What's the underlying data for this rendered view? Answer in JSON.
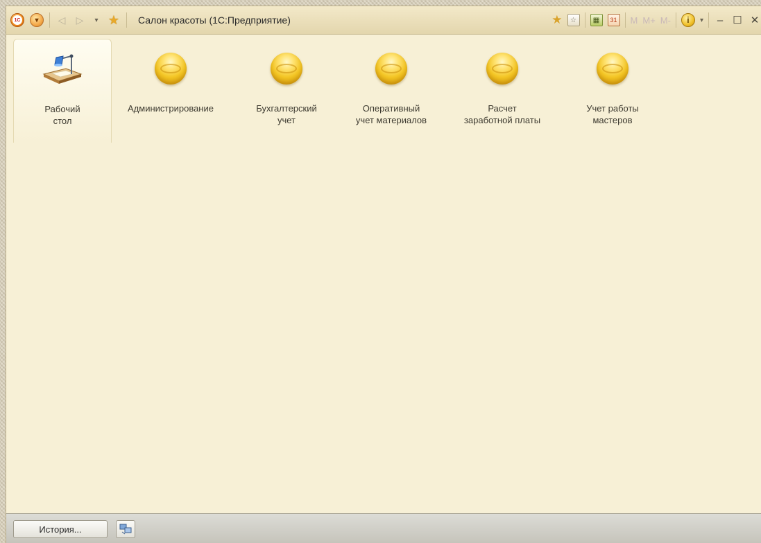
{
  "window": {
    "title": "Салон красоты  (1С:Предприятие)"
  },
  "toolbar_left": {
    "logo_text": "1С",
    "menu_glyph": "▾",
    "back_glyph": "◁",
    "forward_glyph": "▷",
    "history_drop_glyph": "▾",
    "favorites_glyph": "★"
  },
  "toolbar_right": {
    "add_fav_glyph": "★",
    "fav_list_glyph": "☆",
    "calc_glyph": "▦",
    "calendar_glyph": "31",
    "mem_labels": [
      "M",
      "M+",
      "M-"
    ],
    "info_glyph": "i",
    "info_drop_glyph": "▾",
    "minimize_glyph": "–",
    "maximize_glyph": "☐",
    "close_glyph": "✕"
  },
  "sections": [
    {
      "label": "Рабочий\nстол",
      "icon": "desktop-lamp-icon",
      "active": true
    },
    {
      "label": "Администрирование",
      "icon": "section-orb-icon",
      "active": false
    },
    {
      "label": "Бухгалтерский\nучет",
      "icon": "section-orb-icon",
      "active": false
    },
    {
      "label": "Оперативный\nучет материалов",
      "icon": "section-orb-icon",
      "active": false
    },
    {
      "label": "Расчет\nзаработной платы",
      "icon": "section-orb-icon",
      "active": false
    },
    {
      "label": "Учет работы\nмастеров",
      "icon": "section-orb-icon",
      "active": false
    }
  ],
  "statusbar": {
    "history_button": "История...",
    "connections_icon": "connections-icon"
  },
  "colors": {
    "window_bg": "#f7f0d6",
    "orb_gold": "#f3c524",
    "statusbar_bg": "#c6c4bb"
  }
}
